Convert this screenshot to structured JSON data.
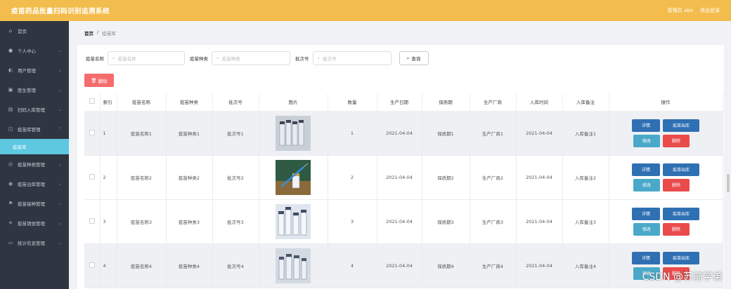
{
  "header": {
    "title": "疫苗药品批量扫码识别追溯系统",
    "admin": "管理员 abo",
    "logout": "退出登录"
  },
  "sidebar": {
    "items": [
      {
        "label": "首页",
        "icon": "home-icon"
      },
      {
        "label": "个人中心",
        "icon": "user-icon"
      },
      {
        "label": "用户管理",
        "icon": "user-circle-icon"
      },
      {
        "label": "医生管理",
        "icon": "medical-icon"
      },
      {
        "label": "扫码入库管理",
        "icon": "scan-icon"
      },
      {
        "label": "疫苗库管理",
        "icon": "box-icon"
      }
    ],
    "sub_item": "疫苗库",
    "items2": [
      {
        "label": "疫苗种类管理",
        "icon": "category-icon"
      },
      {
        "label": "疫苗出库管理",
        "icon": "export-icon"
      },
      {
        "label": "疫苗接种管理",
        "icon": "flag-icon"
      },
      {
        "label": "疫苗销毁管理",
        "icon": "destroy-icon"
      },
      {
        "label": "统计信息管理",
        "icon": "chat-icon"
      }
    ]
  },
  "breadcrumb": {
    "home": "首页",
    "sep": "/",
    "current": "疫苗库"
  },
  "search": {
    "name_label": "疫苗名称",
    "name_placeholder": "疫苗名称",
    "type_label": "疫苗种类",
    "type_placeholder": "疫苗种类",
    "batch_label": "批次号",
    "batch_placeholder": "批次号",
    "query": "查询"
  },
  "delete_button": "删除",
  "table": {
    "headers": [
      "索引",
      "疫苗名称",
      "疫苗种类",
      "批次号",
      "图片",
      "数量",
      "生产日期",
      "保质期",
      "生产厂商",
      "入库时间",
      "入库备注",
      "操作"
    ],
    "rows": [
      {
        "idx": "1",
        "name": "疫苗名称1",
        "type": "疫苗种类1",
        "batch": "批次号1",
        "qty": "1",
        "date": "2021-04-04",
        "shelf": "保质期1",
        "maker": "生产厂商1",
        "in_time": "2021-04-04",
        "note": "入库备注1"
      },
      {
        "idx": "2",
        "name": "疫苗名称2",
        "type": "疫苗种类2",
        "batch": "批次号2",
        "qty": "2",
        "date": "2021-04-04",
        "shelf": "保质期2",
        "maker": "生产厂商2",
        "in_time": "2021-04-04",
        "note": "入库备注2"
      },
      {
        "idx": "3",
        "name": "疫苗名称3",
        "type": "疫苗种类3",
        "batch": "批次号3",
        "qty": "3",
        "date": "2021-04-04",
        "shelf": "保质期3",
        "maker": "生产厂商3",
        "in_time": "2021-04-04",
        "note": "入库备注3"
      },
      {
        "idx": "4",
        "name": "疫苗名称4",
        "type": "疫苗种类4",
        "batch": "批次号4",
        "qty": "4",
        "date": "2021-04-04",
        "shelf": "保质期4",
        "maker": "生产厂商4",
        "in_time": "2021-04-04",
        "note": "入库备注4"
      }
    ],
    "actions": {
      "detail": "详情",
      "out": "疫苗出库",
      "edit": "修改",
      "del": "删除"
    }
  },
  "watermark": "CSDN @苏前学弟",
  "colors": {
    "topbar": "#f3bd4d",
    "sidebar": "#2f3642",
    "active_sub": "#5dc8e0",
    "danger": "#f56c6c",
    "primary": "#2f70b3",
    "info": "#4aa9c9"
  }
}
